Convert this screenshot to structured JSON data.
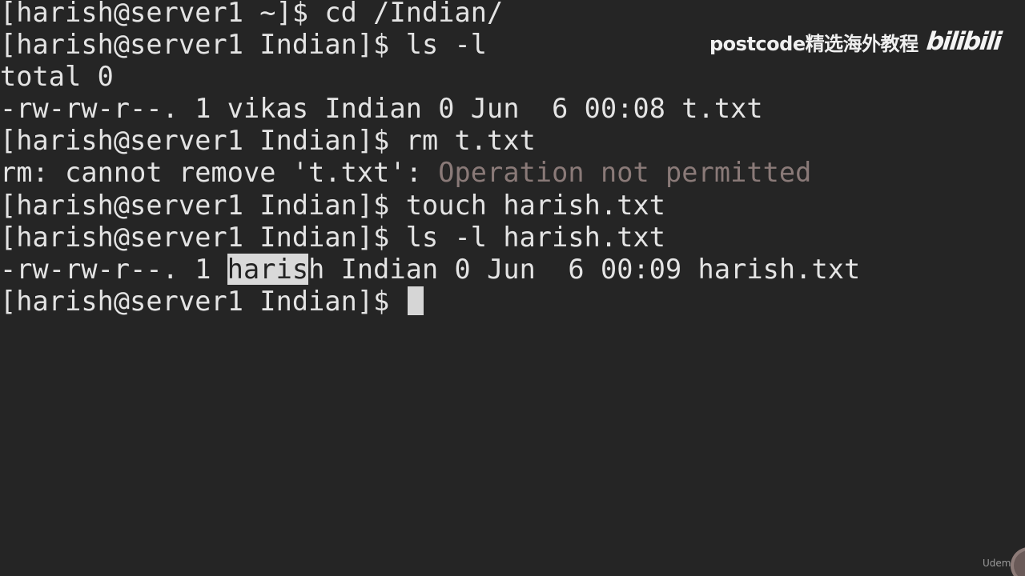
{
  "terminal": {
    "lines": [
      "[harish@server1 ~]$ cd /Indian/",
      "[harish@server1 Indian]$ ls -l",
      "total 0",
      "-rw-rw-r--. 1 vikas Indian 0 Jun  6 00:08 t.txt",
      "[harish@server1 Indian]$ rm t.txt",
      "rm: cannot remove 't.txt': ",
      "[harish@server1 Indian]$ touch harish.txt",
      "[harish@server1 Indian]$ ls -l harish.txt"
    ],
    "error_message": "Operation not permitted",
    "listing_prefix": "-rw-rw-r--. 1 ",
    "listing_selected": "haris",
    "listing_suffix": "h Indian 0 Jun  6 00:09 harish.txt",
    "prompt": "[harish@server1 Indian]$ "
  },
  "watermark": {
    "text": "postcode精选海外教程",
    "logo": "bilibili"
  },
  "udemy_mark": "Udemy",
  "colors": {
    "background": "#252525",
    "foreground": "#e4e4e4",
    "error": "#8a7a78",
    "selection": "#d9d9d9",
    "cursor": "#d6d6d6"
  }
}
